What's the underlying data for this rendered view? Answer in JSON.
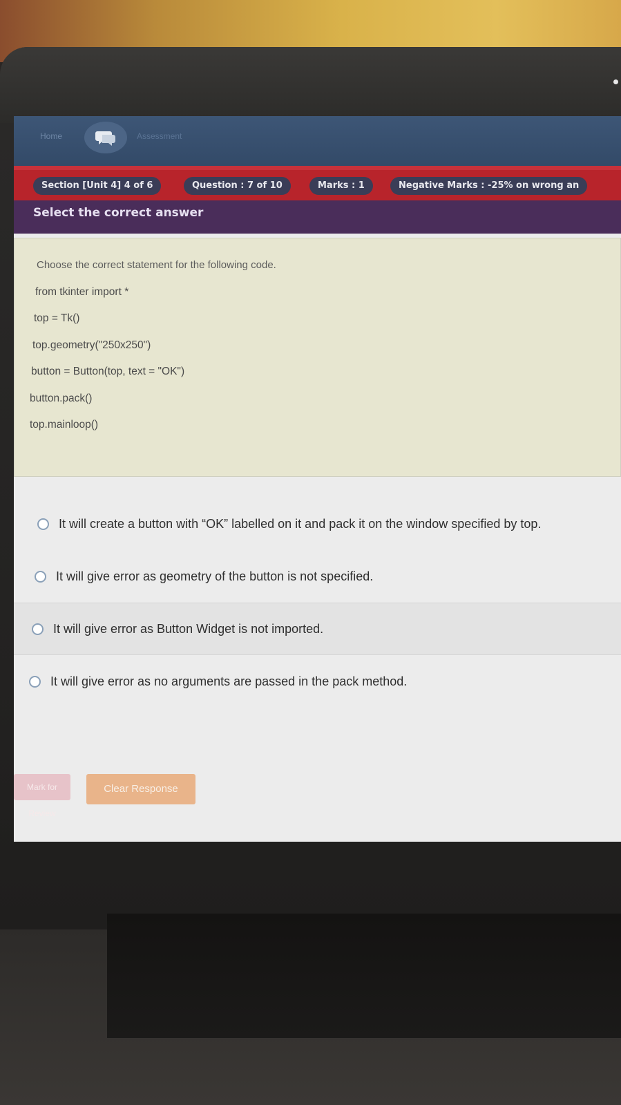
{
  "topbar": {
    "home_label": "Home",
    "faded_label": "Assessment"
  },
  "section_bar": {
    "section": "Section [Unit 4] 4 of 6",
    "question": "Question : 7 of 10",
    "marks": "Marks : 1",
    "negative": "Negative Marks : -25% on wrong an"
  },
  "instruction": "Select the correct answer",
  "question": {
    "prompt": "Choose the correct statement for the following code.",
    "code": [
      "from tkinter import *",
      "top = Tk()",
      "top.geometry(\"250x250\")",
      "button = Button(top, text = \"OK\")",
      "button.pack()",
      "top.mainloop()"
    ]
  },
  "options": [
    "It will create a button with “OK” labelled on it and pack it on the window specified by top.",
    "It will give error as geometry of the button is not specified.",
    "It will give error as Button Widget is not imported.",
    "It will give error as no arguments are passed in the pack method."
  ],
  "buttons": {
    "mark_label": "Mark for Review",
    "clear_label": "Clear Response"
  },
  "colors": {
    "section_bar": "#b8242b",
    "pill_bg": "#3a3d57",
    "instruction_bg": "#4a2d5a",
    "clear_button": "#e9b48a"
  }
}
